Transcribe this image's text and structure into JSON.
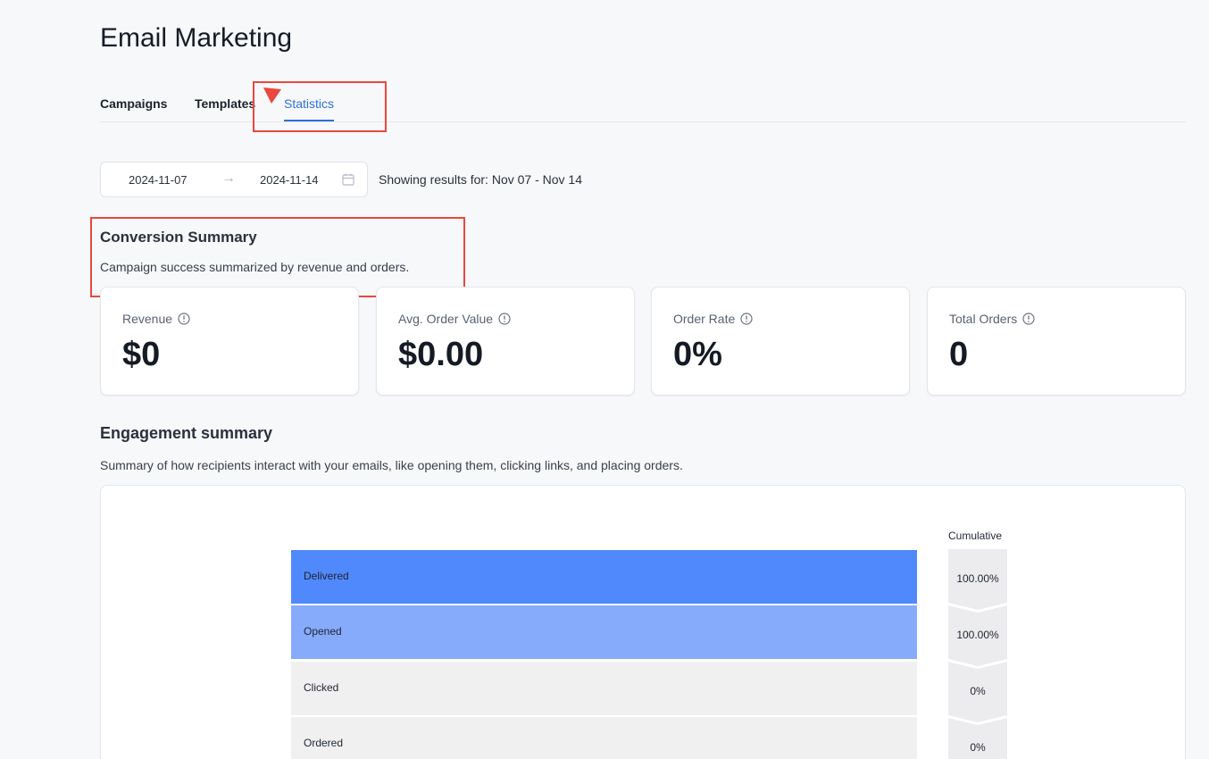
{
  "page": {
    "title": "Email Marketing"
  },
  "tabs": [
    {
      "label": "Campaigns",
      "active": false
    },
    {
      "label": "Templates",
      "active": false
    },
    {
      "label": "Statistics",
      "active": true
    }
  ],
  "filters": {
    "start_date": "2024-11-07",
    "end_date": "2024-11-14",
    "results_text": "Showing results for: Nov 07 - Nov 14"
  },
  "conversion": {
    "title": "Conversion Summary",
    "description": "Campaign success summarized by revenue and orders.",
    "metrics": [
      {
        "label": "Revenue",
        "value": "$0"
      },
      {
        "label": "Avg. Order Value",
        "value": "$0.00"
      },
      {
        "label": "Order Rate",
        "value": "0%"
      },
      {
        "label": "Total Orders",
        "value": "0"
      }
    ]
  },
  "engagement": {
    "title": "Engagement summary",
    "description": "Summary of how recipients interact with your emails, like opening them, clicking links, and placing orders.",
    "cumulative_label": "Cumulative",
    "stages": [
      {
        "label": "Delivered",
        "cumulative": "100.00%",
        "color": "#5089fb"
      },
      {
        "label": "Opened",
        "cumulative": "100.00%",
        "color": "#86abfb"
      },
      {
        "label": "Clicked",
        "cumulative": "0%",
        "color": "#f0f0f0"
      },
      {
        "label": "Ordered",
        "cumulative": "0%",
        "color": "#f0f0f0"
      }
    ]
  },
  "colors": {
    "accent": "#2f6fdd",
    "highlight": "#e9473f"
  }
}
